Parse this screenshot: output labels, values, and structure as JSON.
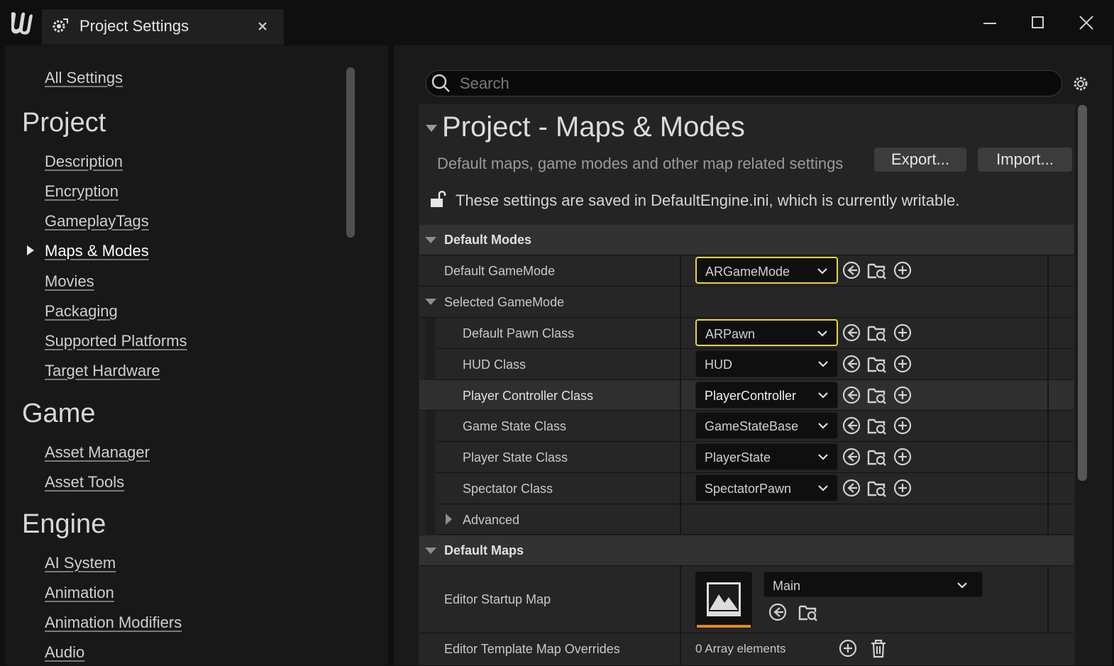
{
  "window": {
    "tab_title": "Project Settings"
  },
  "sidebar": {
    "all_settings": "All Settings",
    "categories": [
      {
        "title": "Project",
        "items": [
          "Description",
          "Encryption",
          "GameplayTags",
          "Maps & Modes",
          "Movies",
          "Packaging",
          "Supported Platforms",
          "Target Hardware"
        ]
      },
      {
        "title": "Game",
        "items": [
          "Asset Manager",
          "Asset Tools"
        ]
      },
      {
        "title": "Engine",
        "items": [
          "AI System",
          "Animation",
          "Animation Modifiers",
          "Audio"
        ]
      }
    ],
    "selected_item": "Maps & Modes"
  },
  "search": {
    "placeholder": "Search"
  },
  "page": {
    "title": "Project - Maps & Modes",
    "description": "Default maps, game modes and other map related settings",
    "export_label": "Export...",
    "import_label": "Import...",
    "info_text": "These settings are saved in DefaultEngine.ini, which is currently writable."
  },
  "default_modes": {
    "header": "Default Modes",
    "default_gamemode_label": "Default GameMode",
    "default_gamemode_value": "ARGameMode",
    "selected_gamemode_label": "Selected GameMode",
    "classes": [
      {
        "label": "Default Pawn Class",
        "value": "ARPawn"
      },
      {
        "label": "HUD Class",
        "value": "HUD"
      },
      {
        "label": "Player Controller Class",
        "value": "PlayerController"
      },
      {
        "label": "Game State Class",
        "value": "GameStateBase"
      },
      {
        "label": "Player State Class",
        "value": "PlayerState"
      },
      {
        "label": "Spectator Class",
        "value": "SpectatorPawn"
      }
    ],
    "advanced_label": "Advanced"
  },
  "default_maps": {
    "header": "Default Maps",
    "editor_startup_map_label": "Editor Startup Map",
    "editor_startup_map_value": "Main",
    "editor_template_overrides_label": "Editor Template Map Overrides",
    "array_elements": "0 Array elements"
  },
  "colors": {
    "selection_outline": "#e8d441",
    "asset_thumbnail_accent": "#e48a1f"
  }
}
